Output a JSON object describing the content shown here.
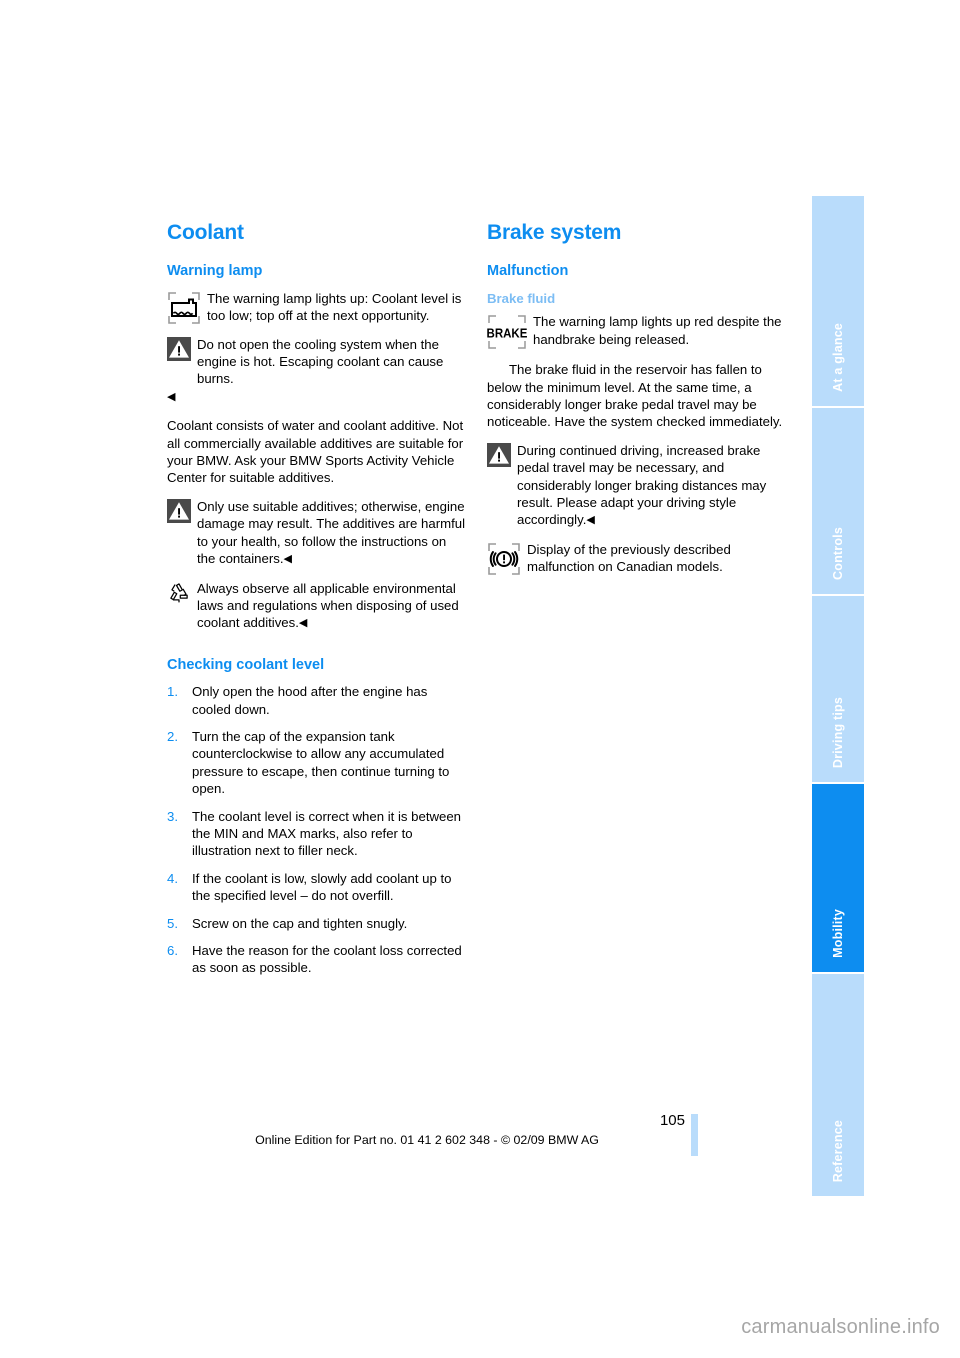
{
  "document": {
    "page_number": "105",
    "footer_text": "Online Edition for Part no. 01 41 2 602 348 - © 02/09 BMW AG",
    "watermark": "carmanualsonline.info"
  },
  "colors": {
    "heading_blue": "#0d8df0",
    "light_blue": "#7cbdf4",
    "tab_blue": "#b9dcfb",
    "tab_active_blue": "#0d8df0"
  },
  "tab_rail": {
    "tabs": [
      {
        "label": "At a glance",
        "active": false
      },
      {
        "label": "Controls",
        "active": false
      },
      {
        "label": "Driving tips",
        "active": false
      },
      {
        "label": "Mobility",
        "active": true
      },
      {
        "label": "Reference",
        "active": false
      }
    ]
  },
  "left_column": {
    "title": "Coolant",
    "warning_lamp_heading": "Warning lamp",
    "coolant_lamp_icon": "coolant-level-warning-lamp-icon",
    "coolant_lamp_text": "The warning lamp lights up: Coolant level is too low; top off at the next opportunity.",
    "hot_engine_icon": "warning-triangle-icon",
    "hot_engine_text": "Do not open the cooling system when the engine is hot. Escaping coolant can cause burns.",
    "hot_engine_endmark": "◀",
    "additive_para": "Coolant consists of water and coolant additive. Not all commercially available additives are suitable for your BMW. Ask your BMW Sports Activity Vehicle Center for suitable additives.",
    "suitable_additives_icon": "warning-triangle-icon",
    "suitable_additives_text": "Only use suitable additives; otherwise, engine damage may result. The additives are harmful to your health, so follow the instructions on the containers.",
    "suitable_additives_endmark": "◀",
    "recycle_icon": "recycling-icon",
    "recycle_text": "Always observe all applicable environmental laws and regulations when disposing of used coolant additives.",
    "recycle_endmark": "◀",
    "checking_heading": "Checking coolant level",
    "steps": [
      {
        "num": "1.",
        "text": "Only open the hood after the engine has cooled down."
      },
      {
        "num": "2.",
        "text": "Turn the cap of the expansion tank counterclockwise to allow any accumulated pressure to escape, then continue turning to open."
      },
      {
        "num": "3.",
        "text": "The coolant level is correct when it is between the MIN and MAX marks, also refer to illustration next to filler neck."
      },
      {
        "num": "4.",
        "text": "If the coolant is low, slowly add coolant up to the specified level – do not overfill."
      },
      {
        "num": "5.",
        "text": "Screw on the cap and tighten snugly."
      },
      {
        "num": "6.",
        "text": "Have the reason for the coolant loss corrected as soon as possible."
      }
    ]
  },
  "right_column": {
    "title": "Brake system",
    "malfunction_heading": "Malfunction",
    "brake_fluid_heading": "Brake fluid",
    "brake_lamp_icon": "brake-warning-lamp-icon",
    "brake_lamp_icon_label": "BRAKE",
    "brake_lamp_text": "The warning lamp lights up red despite the handbrake being released.",
    "brake_fluid_para": "The brake fluid in the reservoir has fallen to below the minimum level. At the same time, a considerably longer brake pedal travel may be noticeable. Have the system checked immediately.",
    "continued_driving_icon": "warning-triangle-icon",
    "continued_driving_text": "During continued driving, increased brake pedal travel may be necessary, and considerably longer braking distances may result. Please adapt your driving style accordingly.",
    "continued_driving_endmark": "◀",
    "canadian_icon": "canadian-brake-warning-lamp-icon",
    "canadian_text": "Display of the previously described malfunction on Canadian models."
  }
}
